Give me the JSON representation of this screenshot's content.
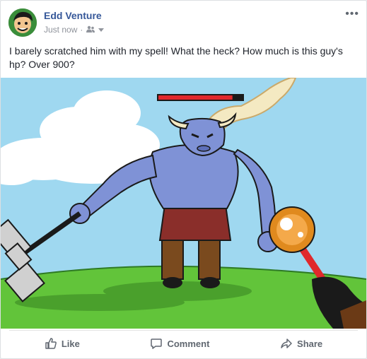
{
  "post": {
    "author": "Edd Venture",
    "time": "Just now",
    "separator": "·",
    "audience_icon": "friends-icon",
    "text": "I barely scratched him with my spell! What the heck? How much is this guy's hp? Over 900?"
  },
  "actions": {
    "like": "Like",
    "comment": "Comment",
    "share": "Share"
  },
  "image": {
    "boss_hp_fraction": 0.88,
    "sky_color": "#9fd8f0",
    "grass_color": "#62c43a"
  },
  "colors": {
    "author_link": "#365899",
    "meta_text": "#90949c",
    "action_text": "#606770"
  }
}
